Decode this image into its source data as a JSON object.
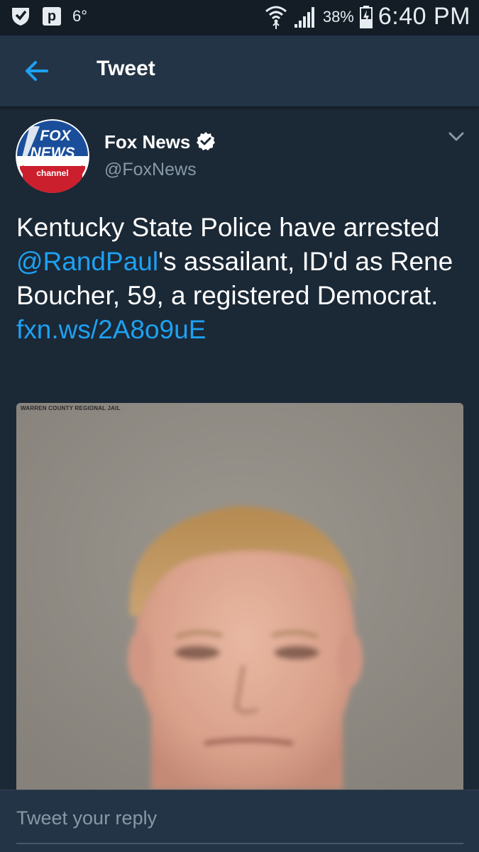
{
  "status_bar": {
    "temperature": "6°",
    "p_icon_letter": "p",
    "battery_percent": "38%",
    "time": "6:40 PM"
  },
  "app_bar": {
    "title": "Tweet",
    "back_icon": "arrow-left-icon"
  },
  "tweet": {
    "author_name": "Fox News",
    "author_handle": "@FoxNews",
    "verified": true,
    "avatar": {
      "line1": "FOX",
      "line2": "NEWS",
      "line3": "channel"
    },
    "text_part1": "Kentucky State Police have arrested ",
    "mention": "@RandPaul",
    "text_part2": "'s assailant, ID'd as Rene Boucher, 59, a registered Democrat. ",
    "link_text": "fxn.ws/2A8o9uE",
    "media": {
      "caption": "WARREN COUNTY REGIONAL JAIL"
    }
  },
  "reply": {
    "placeholder": "Tweet your reply"
  },
  "colors": {
    "background": "#1b2836",
    "app_bar": "#243447",
    "status_bar": "#141d26",
    "link": "#1da1f2",
    "secondary_text": "#8899a6"
  }
}
